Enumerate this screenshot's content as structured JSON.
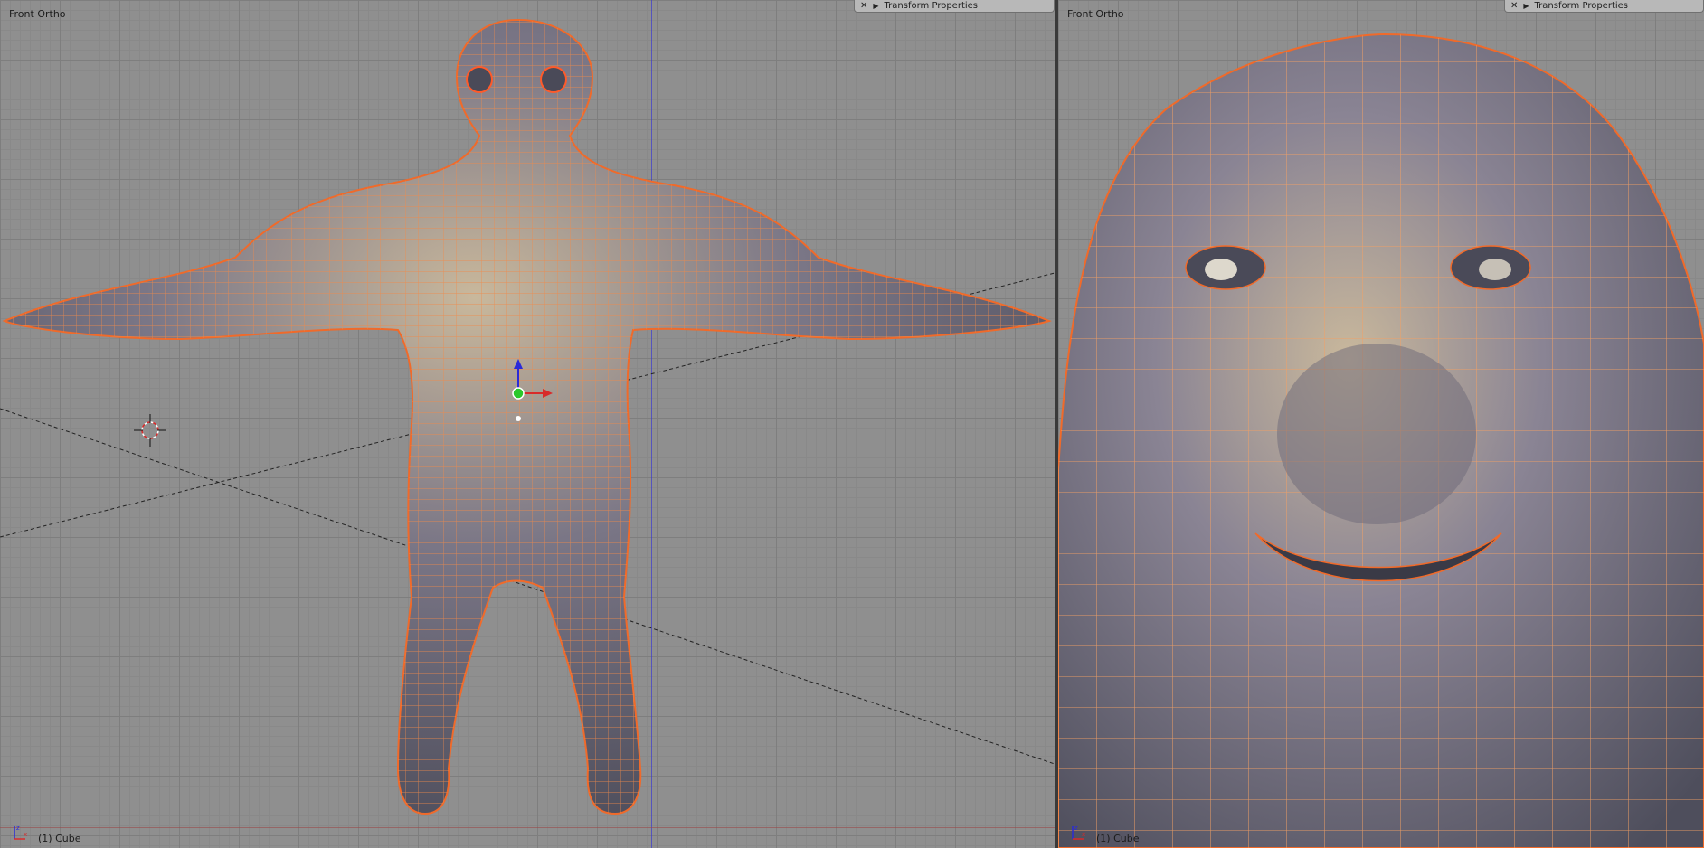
{
  "left_view": {
    "label": "Front Ortho",
    "panel_title": "Transform Properties",
    "object_label": "(1) Cube"
  },
  "right_view": {
    "label": "Front Ortho",
    "panel_title": "Transform Properties",
    "object_label": "(1) Cube"
  },
  "colors": {
    "background": "#8f8f8f",
    "grid": "#7e7e7e",
    "mesh": "#5e5e6c",
    "wire": "#f08a4a",
    "panel": "#b8b8b8"
  },
  "icons": [
    "close-icon",
    "collapse-arrow-icon",
    "3d-cursor-icon",
    "transform-manipulator-icon",
    "axis-gizmo-icon"
  ]
}
